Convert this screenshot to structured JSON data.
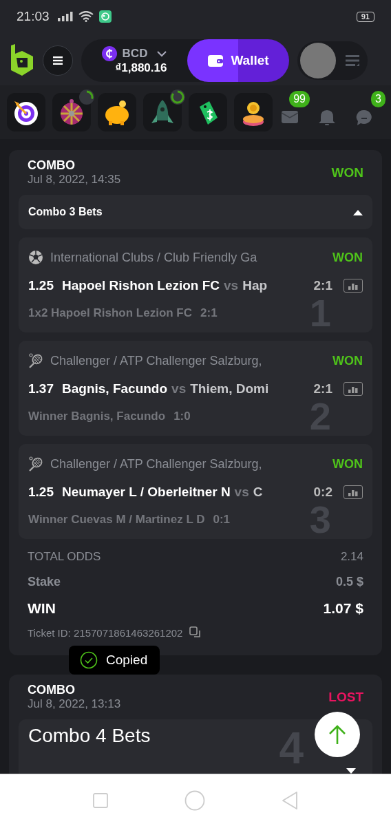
{
  "status_bar": {
    "time": "21:03",
    "battery": "91"
  },
  "header": {
    "currency": "BCD",
    "balance": "₫1,880.16",
    "wallet_button": "Wallet"
  },
  "quick_icons": [
    {
      "kind": "target"
    },
    {
      "kind": "wheel"
    },
    {
      "kind": "piggy"
    },
    {
      "kind": "rocket"
    },
    {
      "kind": "tag"
    },
    {
      "kind": "coin"
    }
  ],
  "notifications": [
    {
      "kind": "mail",
      "badge": "99"
    },
    {
      "kind": "bell"
    },
    {
      "kind": "chat",
      "badge": "3"
    }
  ],
  "bets": [
    {
      "type": "COMBO",
      "date": "Jul 8, 2022, 14:35",
      "status": "WON",
      "group": {
        "label": "Combo 3 Bets",
        "expanded": true,
        "large": false
      },
      "legs": [
        {
          "kind": "soccer",
          "league": "International Clubs / Club Friendly Ga",
          "status": "WON",
          "odds": "1.25",
          "home": "Hapoel Rishon Lezion FC",
          "vs": "vs",
          "away": "Hap",
          "score": "2:1",
          "selection": "1x2 Hapoel Rishon Lezion FC",
          "selection_score": "2:1",
          "number": "1"
        },
        {
          "kind": "tennis",
          "league": "Challenger / ATP Challenger Salzburg,",
          "status": "WON",
          "odds": "1.37",
          "home": "Bagnis, Facundo",
          "vs": "vs",
          "away": "Thiem, Domi",
          "score": "2:1",
          "selection": "Winner Bagnis, Facundo",
          "selection_score": "1:0",
          "number": "2"
        },
        {
          "kind": "tennis",
          "league": "Challenger / ATP Challenger Salzburg,",
          "status": "WON",
          "odds": "1.25",
          "home": "Neumayer L / Oberleitner N",
          "vs": "vs",
          "away": "C",
          "score": "0:2",
          "selection": "Winner Cuevas M / Martinez L D",
          "selection_score": "0:1",
          "number": "3"
        }
      ],
      "total_odds": {
        "label": "TOTAL ODDS",
        "value": "2.14"
      },
      "stake": {
        "label": "Stake",
        "value": "0.5 $"
      },
      "win": {
        "label": "WIN",
        "value": "1.07 $"
      },
      "ticket": "Ticket ID: 2157071861463261202"
    },
    {
      "type": "COMBO",
      "date": "Jul 8, 2022, 13:13",
      "status": "LOST",
      "group": {
        "label": "Combo 4 Bets",
        "expanded": false,
        "large": true,
        "number": "4"
      }
    }
  ],
  "toast": {
    "text": "Copied"
  }
}
